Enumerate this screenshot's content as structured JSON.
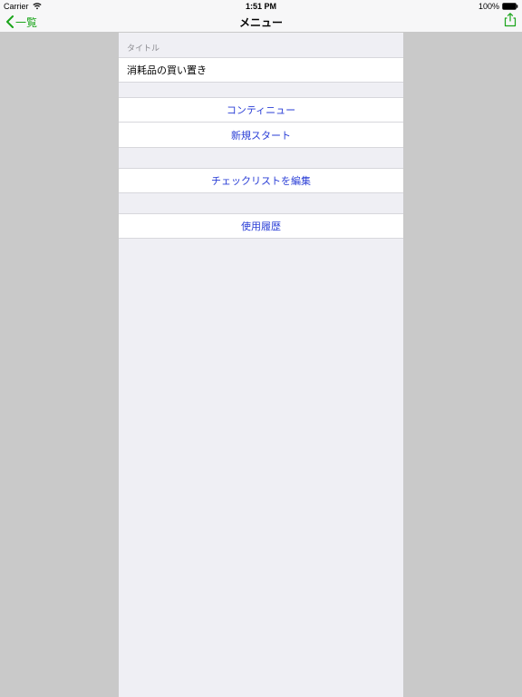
{
  "statusbar": {
    "carrier": "Carrier",
    "time": "1:51 PM",
    "battery": "100%"
  },
  "navbar": {
    "back": "一覧",
    "title": "メニュー"
  },
  "section": {
    "title_header": "タイトル",
    "title_value": "消耗品の買い置き"
  },
  "actions": {
    "continue": "コンティニュー",
    "new_start": "新規スタート",
    "edit_checklist": "チェックリストを編集",
    "history": "使用履歴"
  }
}
